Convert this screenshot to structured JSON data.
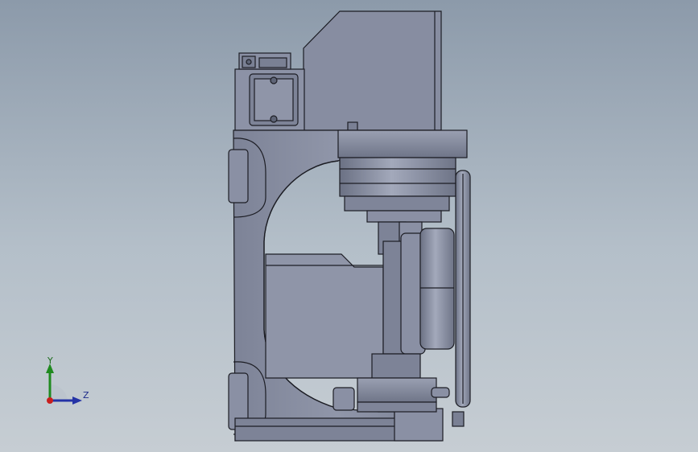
{
  "triad": {
    "y_label": "Y",
    "z_label": "Z",
    "y_color": "#1f8a1f",
    "z_color": "#2433a6",
    "x_color": "#c81e1e"
  },
  "model": {
    "body_color": "#8a90a4",
    "edge_color": "#1c1d24",
    "shade_color": "#6d7386",
    "highlight_color": "#a2a8ba"
  }
}
